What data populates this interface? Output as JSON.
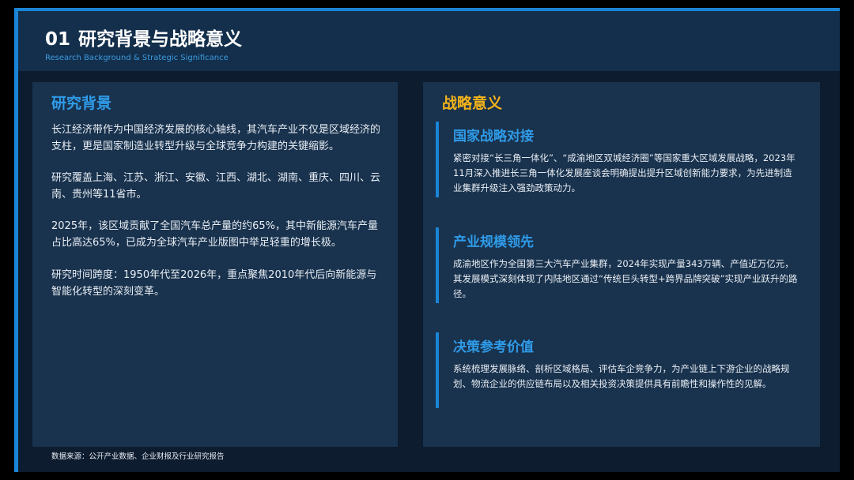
{
  "header": {
    "number": "01",
    "title": "研究背景与战略意义",
    "subtitle": "Research Background & Strategic Significance"
  },
  "background": {
    "title": "研究背景",
    "paragraphs": [
      "长江经济带作为中国经济发展的核心轴线，其汽车产业不仅是区域经济的支柱，更是国家制造业转型升级与全球竞争力构建的关键缩影。",
      "研究覆盖上海、江苏、浙江、安徽、江西、湖北、湖南、重庆、四川、云南、贵州等11省市。",
      "2025年，该区域贡献了全国汽车总产量的约65%，其中新能源汽车产量占比高达65%，已成为全球汽车产业版图中举足轻重的增长极。",
      "研究时间跨度：1950年代至2026年，重点聚焦2010年代后向新能源与智能化转型的深刻变革。"
    ]
  },
  "significance": {
    "title": "战略意义",
    "items": [
      {
        "title": "国家战略对接",
        "text": "紧密对接“长三角一体化”、“成渝地区双城经济圈”等国家重大区域发展战略，2023年11月深入推进长三角一体化发展座谈会明确提出提升区域创新能力要求，为先进制造业集群升级注入强劲政策动力。"
      },
      {
        "title": "产业规模领先",
        "text": "成渝地区作为全国第三大汽车产业集群，2024年实现产量343万辆、产值近万亿元，其发展模式深刻体现了内陆地区通过“传统巨头转型+跨界品牌突破”实现产业跃升的路径。"
      },
      {
        "title": "决策参考价值",
        "text": "系统梳理发展脉络、剖析区域格局、评估车企竞争力，为产业链上下游企业的战略规划、物流企业的供应链布局以及相关投资决策提供具有前瞻性和操作性的见解。"
      }
    ]
  },
  "footer": {
    "source": "数据来源：公开产业数据、企业财报及行业研究报告"
  }
}
